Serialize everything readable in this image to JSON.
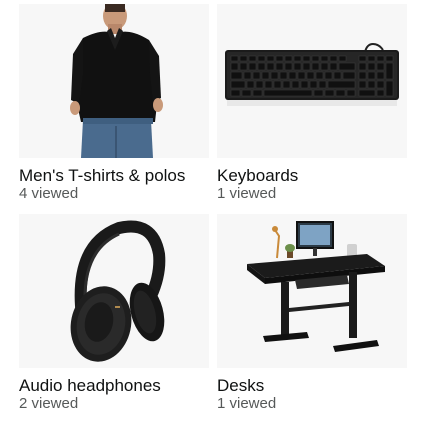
{
  "categories": [
    {
      "label": "Men's T-shirts & polos",
      "count": "4 viewed",
      "icon": "polo-shirt-image"
    },
    {
      "label": "Keyboards",
      "count": "1 viewed",
      "icon": "keyboard-image"
    },
    {
      "label": "Audio headphones",
      "count": "2 viewed",
      "icon": "headphones-image"
    },
    {
      "label": "Desks",
      "count": "1 viewed",
      "icon": "standing-desk-image"
    }
  ]
}
